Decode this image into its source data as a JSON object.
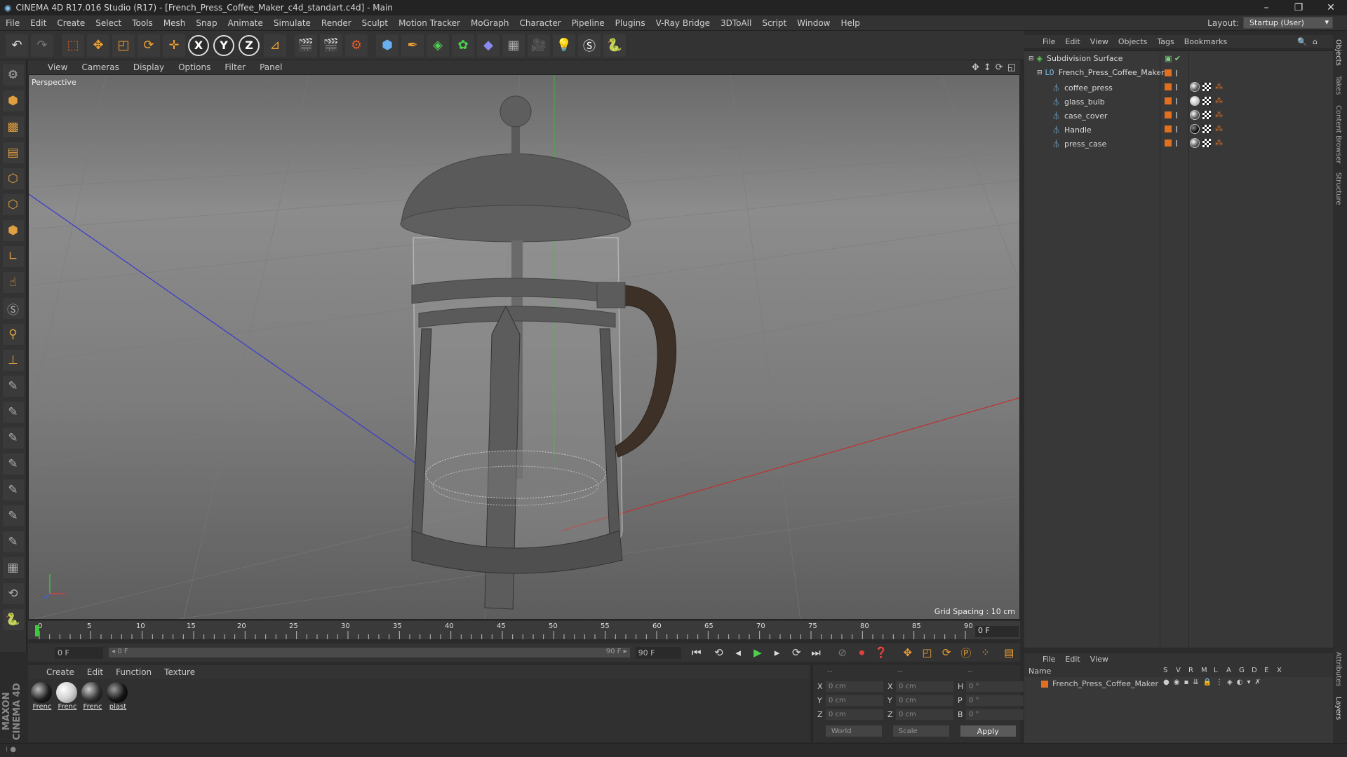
{
  "window": {
    "title": "CINEMA 4D R17.016 Studio (R17) - [French_Press_Coffee_Maker_c4d_standart.c4d] - Main",
    "controls": [
      "–",
      "❐",
      "✕"
    ]
  },
  "menubar": {
    "items": [
      "File",
      "Edit",
      "Create",
      "Select",
      "Tools",
      "Mesh",
      "Snap",
      "Animate",
      "Simulate",
      "Render",
      "Sculpt",
      "Motion Tracker",
      "MoGraph",
      "Character",
      "Pipeline",
      "Plugins",
      "V-Ray Bridge",
      "3DToAll",
      "Script",
      "Window",
      "Help"
    ],
    "layout_label": "Layout:",
    "layout_value": "Startup (User)"
  },
  "viewport": {
    "menu": [
      "View",
      "Cameras",
      "Display",
      "Options",
      "Filter",
      "Panel"
    ],
    "label": "Perspective",
    "grid_spacing": "Grid Spacing : 10 cm"
  },
  "timeline": {
    "ticks": [
      "0",
      "5",
      "10",
      "15",
      "20",
      "25",
      "30",
      "35",
      "40",
      "45",
      "50",
      "55",
      "60",
      "65",
      "70",
      "75",
      "80",
      "85",
      "90"
    ],
    "current_frame": "0 F",
    "start_field": "0 F",
    "range_start": "◂ 0 F",
    "range_end": "90 F ▸",
    "end_field": "90 F"
  },
  "materials": {
    "menu": [
      "Create",
      "Edit",
      "Function",
      "Texture"
    ],
    "items": [
      {
        "name": "Frenc",
        "color": "#1e1e1e"
      },
      {
        "name": "Frenc",
        "color": "#d0d0d0"
      },
      {
        "name": "Frenc",
        "color": "#303030"
      },
      {
        "name": "plast",
        "color": "#141414"
      }
    ],
    "brand": "MAXON CINEMA 4D"
  },
  "coordinates": {
    "header": [
      "--",
      "--",
      "--"
    ],
    "rows": [
      {
        "a": "X",
        "v1": "0 cm",
        "b": "X",
        "v2": "0 cm",
        "c": "H",
        "v3": "0 °"
      },
      {
        "a": "Y",
        "v1": "0 cm",
        "b": "Y",
        "v2": "0 cm",
        "c": "P",
        "v3": "0 °"
      },
      {
        "a": "Z",
        "v1": "0 cm",
        "b": "Z",
        "v2": "0 cm",
        "c": "B",
        "v3": "0 °"
      }
    ],
    "mode": "World",
    "transform": "Scale",
    "apply": "Apply"
  },
  "objects": {
    "menu": [
      "File",
      "Edit",
      "View",
      "Objects",
      "Tags",
      "Bookmarks"
    ],
    "items": [
      {
        "name": "Subdivision Surface",
        "depth": 0
      },
      {
        "name": "French_Press_Coffee_Maker",
        "depth": 1
      },
      {
        "name": "coffee_press",
        "depth": 2
      },
      {
        "name": "glass_bulb",
        "depth": 2
      },
      {
        "name": "case_cover",
        "depth": 2
      },
      {
        "name": "Handle",
        "depth": 2
      },
      {
        "name": "press_case",
        "depth": 2
      }
    ]
  },
  "right_tabs": [
    "Objects",
    "Takes",
    "Content Browser",
    "Structure",
    "Attributes",
    "Layers"
  ],
  "layers": {
    "menu": [
      "File",
      "Edit",
      "View"
    ],
    "name_header": "Name",
    "columns": [
      "S",
      "V",
      "R",
      "M",
      "L",
      "A",
      "G",
      "D",
      "E",
      "X"
    ],
    "row_name": "French_Press_Coffee_Maker",
    "row_color": "#e07020"
  },
  "colors": {
    "accent_orange": "#e0a040",
    "play_green": "#4ed04e",
    "record_red": "#e04040",
    "object_icon": "#7dc1f0"
  }
}
